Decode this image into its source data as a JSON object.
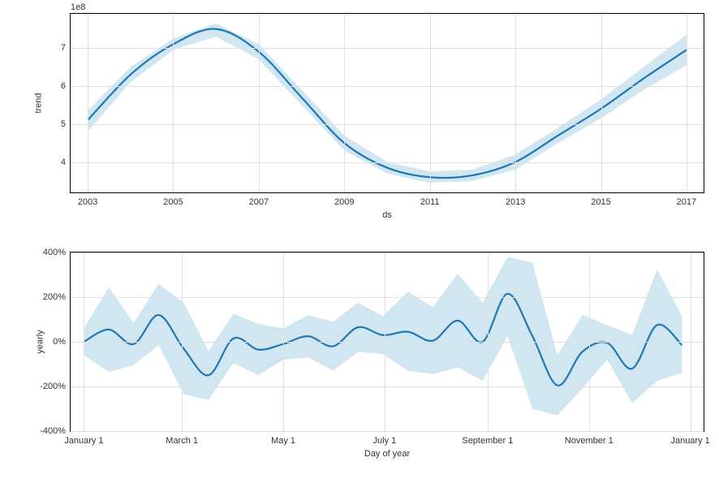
{
  "chart_data": [
    {
      "type": "line",
      "title": "",
      "xlabel": "ds",
      "ylabel": "trend",
      "y_exponent_label": "1e8",
      "xticks": [
        "2003",
        "2005",
        "2007",
        "2009",
        "2011",
        "2013",
        "2015",
        "2017"
      ],
      "yticks": [
        "4",
        "5",
        "6",
        "7"
      ],
      "xlim": [
        2002.6,
        2017.4
      ],
      "ylim": [
        3.2,
        7.9
      ],
      "series": [
        {
          "name": "trend",
          "x": [
            2003,
            2004,
            2005,
            2006,
            2007,
            2008,
            2009,
            2010,
            2011,
            2012,
            2013,
            2014,
            2015,
            2016,
            2017
          ],
          "y": [
            5.1,
            6.3,
            7.1,
            7.5,
            6.9,
            5.7,
            4.5,
            3.85,
            3.6,
            3.65,
            4.0,
            4.7,
            5.4,
            6.2,
            6.95
          ],
          "lower": [
            4.8,
            6.1,
            6.95,
            7.3,
            6.7,
            5.5,
            4.3,
            3.7,
            3.45,
            3.5,
            3.8,
            4.5,
            5.15,
            5.9,
            6.55
          ],
          "upper": [
            5.35,
            6.5,
            7.25,
            7.65,
            7.1,
            5.9,
            4.7,
            4.0,
            3.75,
            3.8,
            4.2,
            4.9,
            5.65,
            6.5,
            7.35
          ]
        }
      ]
    },
    {
      "type": "line",
      "title": "",
      "xlabel": "Day of year",
      "ylabel": "yearly",
      "xticks": [
        "January 1",
        "March 1",
        "May 1",
        "July 1",
        "September 1",
        "November 1",
        "January 1"
      ],
      "yticks": [
        "-400%",
        "-200%",
        "0%",
        "200%",
        "400%"
      ],
      "xlim": [
        -8,
        373
      ],
      "ylim": [
        -400,
        400
      ],
      "series": [
        {
          "name": "yearly",
          "x": [
            0,
            15,
            30,
            45,
            60,
            75,
            90,
            105,
            120,
            135,
            150,
            165,
            180,
            195,
            210,
            225,
            240,
            255,
            270,
            285,
            300,
            315,
            330,
            345,
            360
          ],
          "y": [
            0,
            55,
            -10,
            120,
            -30,
            -150,
            15,
            -35,
            -10,
            25,
            -20,
            65,
            30,
            45,
            5,
            95,
            0,
            215,
            25,
            -195,
            -45,
            -5,
            -120,
            75,
            -15
          ],
          "lower": [
            -60,
            -135,
            -105,
            -15,
            -235,
            -260,
            -95,
            -150,
            -80,
            -70,
            -130,
            -45,
            -55,
            -130,
            -145,
            -115,
            -175,
            25,
            -300,
            -330,
            -210,
            -80,
            -275,
            -175,
            -140
          ],
          "upper": [
            60,
            245,
            85,
            260,
            175,
            -40,
            125,
            80,
            60,
            120,
            90,
            175,
            115,
            225,
            155,
            305,
            175,
            380,
            355,
            -60,
            120,
            75,
            30,
            325,
            115
          ]
        }
      ]
    }
  ],
  "panels": {
    "top": {
      "xlabel": "ds",
      "ylabel": "trend",
      "exp": "1e8"
    },
    "bottom": {
      "xlabel": "Day of year",
      "ylabel": "yearly"
    }
  }
}
